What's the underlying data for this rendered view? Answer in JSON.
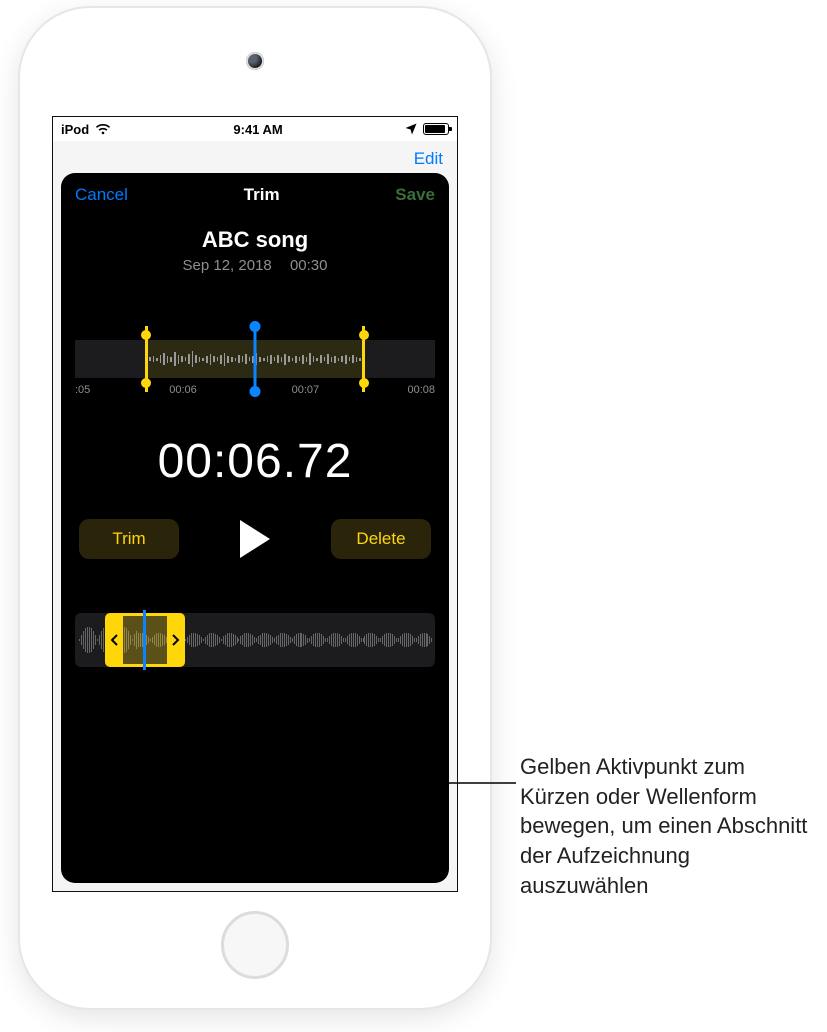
{
  "statusbar": {
    "carrier": "iPod",
    "time": "9:41 AM"
  },
  "underlying": {
    "edit": "Edit"
  },
  "sheet": {
    "cancel": "Cancel",
    "title": "Trim",
    "save": "Save",
    "song_title": "ABC song",
    "song_date": "Sep 12, 2018",
    "song_duration": "00:30",
    "ruler": {
      "t0": ":05",
      "t1": "00:06",
      "t2": "00:07",
      "t3": "00:08"
    },
    "big_time": "00:06.72",
    "trim_btn": "Trim",
    "delete_btn": "Delete"
  },
  "callout": "Gelben Aktivpunkt zum Kürzen oder Wellenform bewegen, um einen Abschnitt der Aufzeichnung auszuwählen"
}
